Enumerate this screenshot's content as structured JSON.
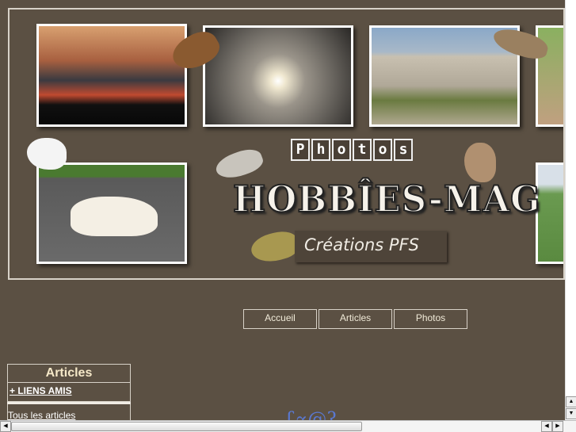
{
  "banner": {
    "photos_label": [
      "P",
      "h",
      "o",
      "t",
      "o",
      "s"
    ],
    "title": "HOBBÎES-MAG",
    "subtitle": "Créations PFS"
  },
  "nav": [
    {
      "label": "Accueil"
    },
    {
      "label": "Articles"
    },
    {
      "label": "Photos"
    }
  ],
  "sidebar": {
    "title": "Articles",
    "items": [
      {
        "label": "+ LIENS AMIS"
      },
      {
        "label": "Tous les articles"
      }
    ]
  },
  "deco": "ʗ∝@ʔ"
}
